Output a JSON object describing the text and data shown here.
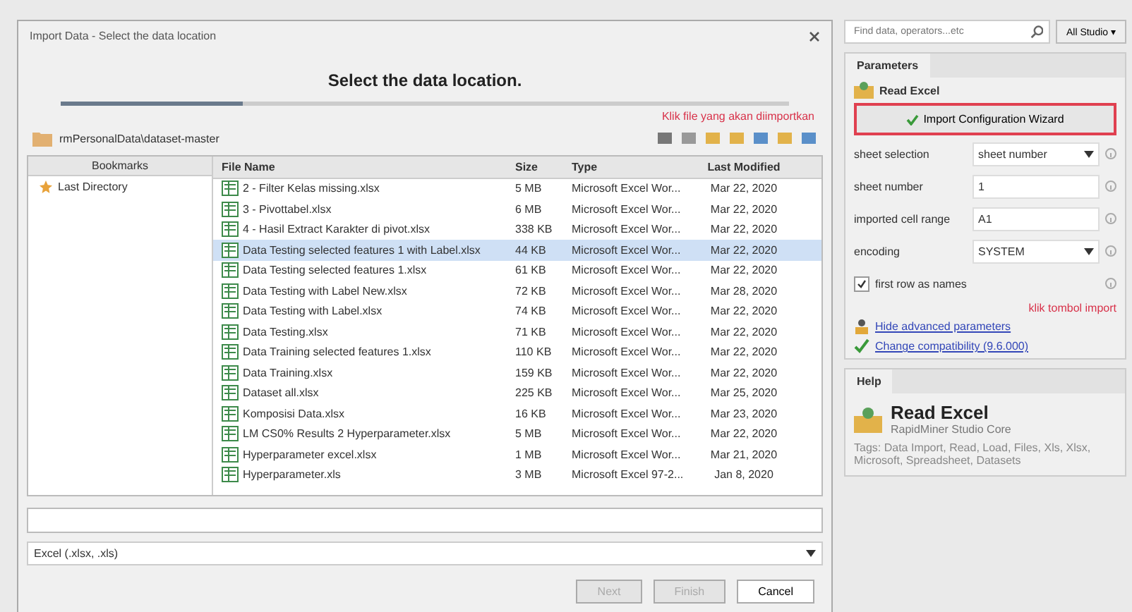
{
  "dialog": {
    "title": "Import Data - Select the data location",
    "heading": "Select the data location.",
    "progress": {
      "level": 0.25
    },
    "path": "rmPersonalData\\dataset-master",
    "annotation": "Klik file yang akan diimportkan",
    "bookmarks": {
      "header": "Bookmarks",
      "items": [
        "Last Directory"
      ]
    },
    "columns": [
      "File Name",
      "Size",
      "Type",
      "Last Modified"
    ],
    "rows": [
      {
        "name": "2 - Filter Kelas missing.xlsx",
        "size": "5 MB",
        "type": "Microsoft Excel Wor...",
        "modified": "Mar 22, 2020",
        "selected": false
      },
      {
        "name": "3 - Pivottabel.xlsx",
        "size": "6 MB",
        "type": "Microsoft Excel Wor...",
        "modified": "Mar 22, 2020",
        "selected": false
      },
      {
        "name": "4 - Hasil Extract Karakter di pivot.xlsx",
        "size": "338 KB",
        "type": "Microsoft Excel Wor...",
        "modified": "Mar 22, 2020",
        "selected": false
      },
      {
        "name": "Data Testing selected features 1 with Label.xlsx",
        "size": "44 KB",
        "type": "Microsoft Excel Wor...",
        "modified": "Mar 22, 2020",
        "selected": true
      },
      {
        "name": "Data Testing selected features 1.xlsx",
        "size": "61 KB",
        "type": "Microsoft Excel Wor...",
        "modified": "Mar 22, 2020",
        "selected": false
      },
      {
        "name": "Data Testing with Label New.xlsx",
        "size": "72 KB",
        "type": "Microsoft Excel Wor...",
        "modified": "Mar 28, 2020",
        "selected": false
      },
      {
        "name": "Data Testing with Label.xlsx",
        "size": "74 KB",
        "type": "Microsoft Excel Wor...",
        "modified": "Mar 22, 2020",
        "selected": false
      },
      {
        "name": "Data Testing.xlsx",
        "size": "71 KB",
        "type": "Microsoft Excel Wor...",
        "modified": "Mar 22, 2020",
        "selected": false
      },
      {
        "name": "Data Training selected features 1.xlsx",
        "size": "110 KB",
        "type": "Microsoft Excel Wor...",
        "modified": "Mar 22, 2020",
        "selected": false
      },
      {
        "name": "Data Training.xlsx",
        "size": "159 KB",
        "type": "Microsoft Excel Wor...",
        "modified": "Mar 22, 2020",
        "selected": false
      },
      {
        "name": "Dataset all.xlsx",
        "size": "225 KB",
        "type": "Microsoft Excel Wor...",
        "modified": "Mar 25, 2020",
        "selected": false
      },
      {
        "name": "Komposisi Data.xlsx",
        "size": "16 KB",
        "type": "Microsoft Excel Wor...",
        "modified": "Mar 23, 2020",
        "selected": false
      },
      {
        "name": "LM CS0% Results 2 Hyperparameter.xlsx",
        "size": "5 MB",
        "type": "Microsoft Excel Wor...",
        "modified": "Mar 22, 2020",
        "selected": false
      },
      {
        "name": "Hyperparameter excel.xlsx",
        "size": "1 MB",
        "type": "Microsoft Excel Wor...",
        "modified": "Mar 21, 2020",
        "selected": false
      },
      {
        "name": "Hyperparameter.xls",
        "size": "3 MB",
        "type": "Microsoft Excel 97-2...",
        "modified": "Jan 8, 2020",
        "selected": false
      }
    ],
    "filter": "Excel (.xlsx, .xls)",
    "buttons": [
      {
        "label": "Next",
        "disabled": true
      },
      {
        "label": "Finish",
        "disabled": true
      },
      {
        "label": "Cancel",
        "disabled": false
      }
    ]
  },
  "side": {
    "search": {
      "placeholder": "Find data, operators...etc"
    },
    "studio_button": "All Studio ▾",
    "parameters": {
      "tab": "Parameters",
      "operator": "Read Excel",
      "wizard_button": "Import Configuration Wizard",
      "annotation": "klik tombol import",
      "params": [
        {
          "kind": "select",
          "label": "sheet selection",
          "value": "sheet number"
        },
        {
          "kind": "text",
          "label": "sheet number",
          "value": "1"
        },
        {
          "kind": "text",
          "label": "imported cell range",
          "value": "A1"
        },
        {
          "kind": "select",
          "label": "encoding",
          "value": "SYSTEM"
        },
        {
          "kind": "check",
          "label": "first row as names",
          "checked": true
        }
      ],
      "links": [
        "Hide advanced parameters",
        "Change compatibility (9.6.000)"
      ]
    },
    "help": {
      "tab": "Help",
      "title": "Read Excel",
      "subtitle": "RapidMiner Studio Core",
      "tags": "Tags: Data Import, Read, Load, Files, Xls, Xlsx, Microsoft, Spreadsheet, Datasets"
    }
  }
}
